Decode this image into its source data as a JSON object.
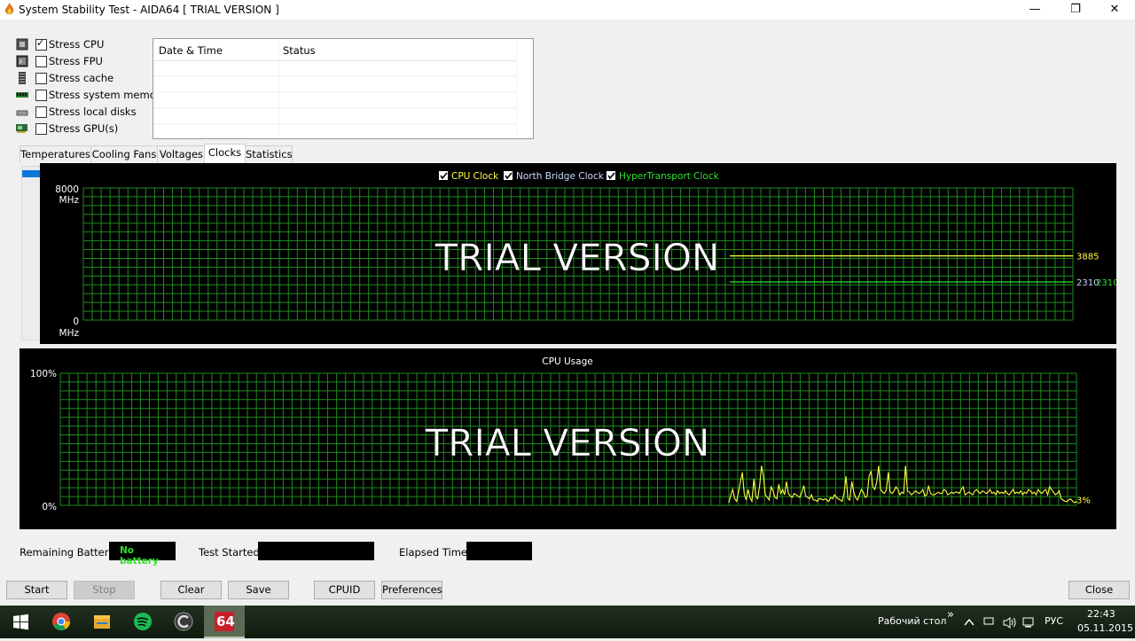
{
  "window": {
    "title": "System Stability Test - AIDA64  [ TRIAL VERSION ]",
    "minimize": "—",
    "restore": "❐",
    "close": "✕"
  },
  "stress": [
    {
      "label": "Stress CPU",
      "checked": true,
      "icon": "cpu-icon"
    },
    {
      "label": "Stress FPU",
      "checked": false,
      "icon": "fpu-icon"
    },
    {
      "label": "Stress cache",
      "checked": false,
      "icon": "cache-icon"
    },
    {
      "label": "Stress system memory",
      "checked": false,
      "icon": "memory-icon"
    },
    {
      "label": "Stress local disks",
      "checked": false,
      "icon": "disk-icon"
    },
    {
      "label": "Stress GPU(s)",
      "checked": false,
      "icon": "gpu-icon"
    }
  ],
  "log": {
    "col_datetime": "Date & Time",
    "col_status": "Status"
  },
  "tabs": [
    {
      "label": "Temperatures",
      "active": false
    },
    {
      "label": "Cooling Fans",
      "active": false
    },
    {
      "label": "Voltages",
      "active": false
    },
    {
      "label": "Clocks",
      "active": true
    },
    {
      "label": "Statistics",
      "active": false
    }
  ],
  "clock_chart": {
    "legend": [
      {
        "label": "CPU Clock",
        "color": "#ffff40",
        "checked": true
      },
      {
        "label": "North Bridge Clock",
        "color": "#c8d8ff",
        "checked": true
      },
      {
        "label": "HyperTransport Clock",
        "color": "#30e030",
        "checked": true
      }
    ],
    "y_max_label": "8000",
    "y_min_label": "0",
    "unit": "MHz",
    "watermark": "TRIAL VERSION",
    "series_values": {
      "cpu": "3885",
      "nb": "2310",
      "ht": "2310"
    }
  },
  "usage_chart": {
    "title": "CPU Usage",
    "y_max_label": "100%",
    "y_min_label": "0%",
    "watermark": "TRIAL VERSION",
    "current_label": "3%"
  },
  "chart_data": [
    {
      "type": "line",
      "ylim": [
        0,
        8000
      ],
      "ylabel": "MHz",
      "series": [
        {
          "name": "CPU Clock",
          "value": 3885
        },
        {
          "name": "North Bridge Clock",
          "value": 2310
        },
        {
          "name": "HyperTransport Clock",
          "value": 2310
        }
      ]
    },
    {
      "type": "line",
      "title": "CPU Usage",
      "ylim": [
        0,
        100
      ],
      "series": [
        {
          "name": "CPU Usage",
          "values": [
            2,
            8,
            12,
            5,
            3,
            10,
            18,
            25,
            9,
            4,
            12,
            6,
            3,
            20,
            7,
            5,
            15,
            30,
            22,
            8,
            6,
            4,
            14,
            11,
            6,
            5,
            16,
            9,
            12,
            8,
            18,
            9,
            7,
            6,
            9,
            8,
            7,
            6,
            10,
            15,
            7,
            6,
            5,
            8,
            4,
            4,
            3,
            5,
            5,
            4,
            5,
            4,
            3,
            6,
            5,
            8,
            6,
            5,
            4,
            3,
            9,
            22,
            5,
            4,
            18,
            10,
            6,
            4,
            8,
            12,
            10,
            6,
            7,
            22,
            26,
            14,
            12,
            18,
            30,
            12,
            10,
            9,
            12,
            25,
            10,
            9,
            11,
            14,
            12,
            8,
            10,
            9,
            30,
            11,
            10,
            8,
            9,
            11,
            10,
            9,
            10,
            12,
            7,
            8,
            15,
            9,
            8,
            8,
            9,
            10,
            9,
            9,
            12,
            11,
            8,
            9,
            10,
            9,
            10,
            10,
            9,
            12,
            14,
            8,
            9,
            10,
            9,
            8,
            11,
            12,
            10,
            9,
            11,
            10,
            9,
            10,
            12,
            9,
            10,
            8,
            11,
            9,
            10,
            9,
            11,
            9,
            8,
            10,
            12,
            9,
            10,
            9,
            11,
            8,
            10,
            9,
            12,
            11,
            9,
            10,
            8,
            12,
            10,
            9,
            11,
            12,
            8,
            14,
            12,
            10,
            8,
            9,
            11,
            5,
            4,
            3,
            3,
            4,
            5,
            3,
            2,
            3
          ]
        }
      ],
      "current": 3
    }
  ],
  "bottom": {
    "battery_label": "Remaining Battery:",
    "battery_value": "No battery",
    "started_label": "Test Started:",
    "started_value": "",
    "elapsed_label": "Elapsed Time:",
    "elapsed_value": ""
  },
  "buttons": {
    "start": "Start",
    "stop": "Stop",
    "clear": "Clear",
    "save": "Save",
    "cpuid": "CPUID",
    "preferences": "Preferences",
    "close": "Close"
  },
  "taskbar": {
    "apps": [
      "windows-logo-icon",
      "chrome-icon",
      "file-explorer-icon",
      "spotify-icon",
      "app-icon",
      "aida64-icon"
    ],
    "aida_label": "64",
    "desktop_label": "Рабочий стол",
    "chevron": "»",
    "lang": "РУС",
    "time": "22:43",
    "date": "05.11.2015"
  }
}
